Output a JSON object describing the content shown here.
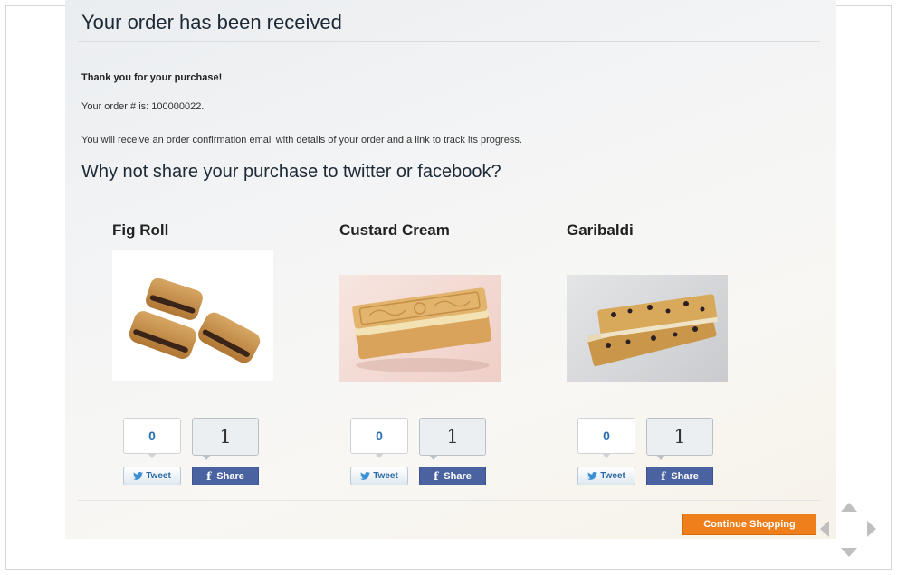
{
  "header": {
    "title": "Your order has been received"
  },
  "confirmation": {
    "thanks": "Thank you for your purchase!",
    "order_number_line": "Your order # is: 100000022.",
    "email_note": "You will receive an order confirmation email with details of your order and a link to track its progress."
  },
  "share": {
    "heading": "Why not share your purchase to twitter or facebook?"
  },
  "products": [
    {
      "name": "Fig Roll",
      "image_icon": "fig-roll-biscuit-image",
      "tweet_count": "0",
      "share_count": "1",
      "tweet_label": "Tweet",
      "share_label": "Share"
    },
    {
      "name": "Custard Cream",
      "image_icon": "custard-cream-biscuit-image",
      "tweet_count": "0",
      "share_count": "1",
      "tweet_label": "Tweet",
      "share_label": "Share"
    },
    {
      "name": "Garibaldi",
      "image_icon": "garibaldi-biscuit-image",
      "tweet_count": "0",
      "share_count": "1",
      "tweet_label": "Tweet",
      "share_label": "Share"
    }
  ],
  "actions": {
    "continue_label": "Continue Shopping"
  },
  "colors": {
    "accent_orange": "#ef7f1a",
    "facebook_blue": "#4a63a0",
    "twitter_blue": "#2a6eb0",
    "heading_text": "#1d2a36"
  }
}
